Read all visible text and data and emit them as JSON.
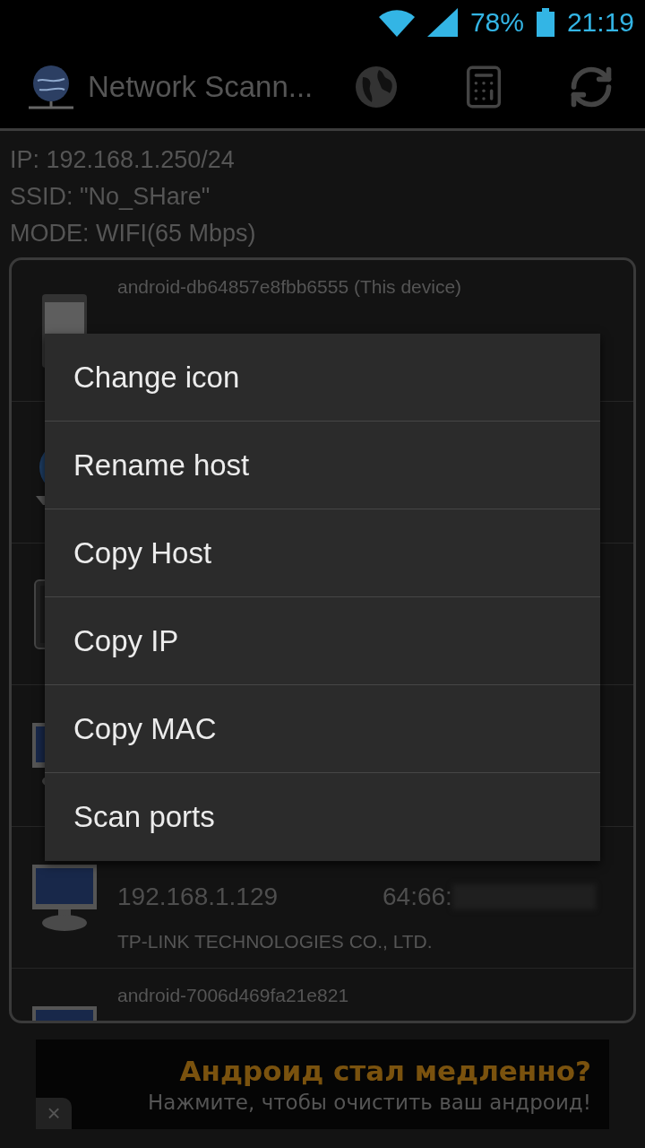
{
  "status_bar": {
    "battery": "78%",
    "time": "21:19"
  },
  "action_bar": {
    "title": "Network Scann..."
  },
  "info": [
    "IP: 192.168.1.250/24",
    "SSID: \"No_SHare\"",
    "MODE: WIFI(65 Mbps)"
  ],
  "hosts": [
    {
      "kind": "phone",
      "name": "android-db64857e8fbb6555 (This device)"
    },
    {
      "kind": "globe"
    },
    {
      "kind": "tablet"
    },
    {
      "kind": "monitor"
    },
    {
      "kind": "monitor",
      "ip": "192.168.1.129",
      "mac": "64:66:",
      "vendor": "TP-LINK TECHNOLOGIES CO., LTD."
    },
    {
      "kind": "monitor",
      "name": "android-7006d469fa21e821"
    }
  ],
  "context_menu": [
    "Change icon",
    "Rename host",
    "Copy Host",
    "Copy IP",
    "Copy MAC",
    "Scan ports"
  ],
  "ad": {
    "title": "Андроид стал медленно?",
    "subtitle": "Нажмите, чтобы очистить ваш андроид!",
    "close": "×"
  }
}
